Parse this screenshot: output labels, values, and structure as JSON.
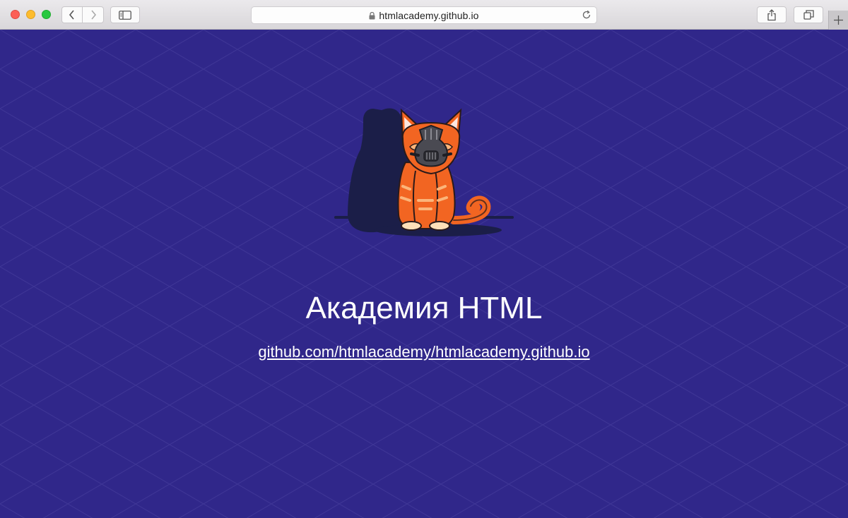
{
  "browser": {
    "address": "htmlacademy.github.io",
    "controls": {
      "back": "chevron-left-icon",
      "forward": "chevron-right-icon",
      "sidebar": "sidebar-icon",
      "share": "share-icon",
      "tabs": "tabs-overview-icon",
      "new_tab": "plus-icon"
    }
  },
  "page": {
    "title": "Академия HTML",
    "link": "github.com/htmlacademy/htmlacademy.github.io",
    "logo": "masked-cat-logo",
    "colors": {
      "background": "#30278a",
      "text": "#ffffff",
      "cat_orange": "#f26522",
      "shadow": "#1b1e48"
    }
  }
}
